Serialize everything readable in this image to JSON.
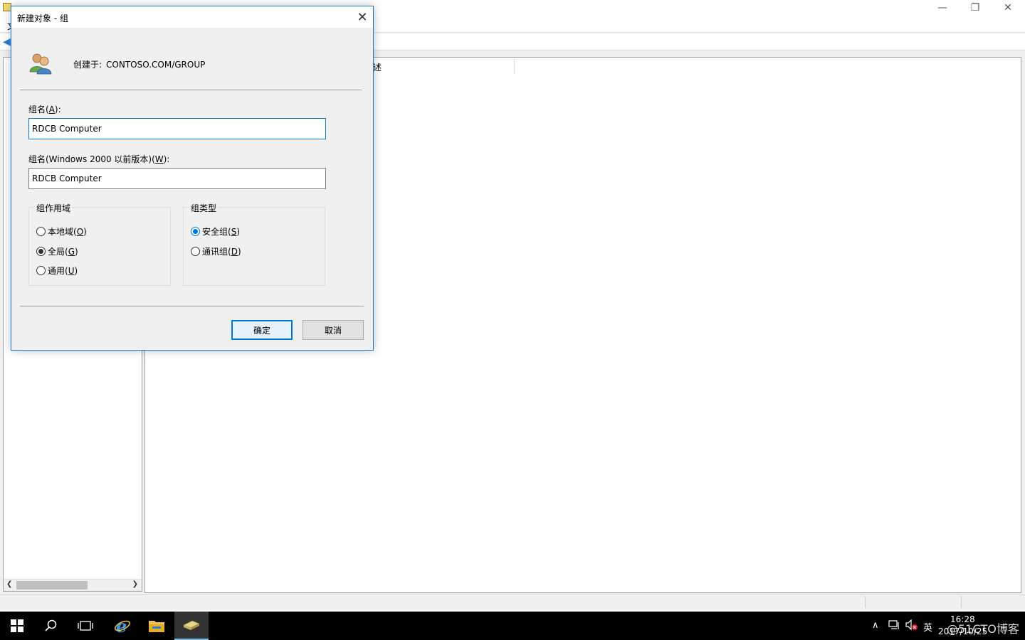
{
  "background_window": {
    "menu_first": "文",
    "column_desc": "述"
  },
  "dialog": {
    "title": "新建对象 - 组",
    "created_in_label": "创建于:",
    "created_in_path": "CONTOSO.COM/GROUP",
    "group_name": {
      "label_prefix": "组名(",
      "label_key": "A",
      "label_suffix": "):",
      "value": "RDCB Computer"
    },
    "group_name_pre2000": {
      "label_prefix": "组名(Windows 2000 以前版本)(",
      "label_key": "W",
      "label_suffix": "):",
      "value": "RDCB Computer"
    },
    "scope": {
      "legend": "组作用域",
      "options": [
        {
          "text": "本地域(",
          "key": "O",
          "end": ")",
          "checked": false
        },
        {
          "text": "全局(",
          "key": "G",
          "end": ")",
          "checked": true
        },
        {
          "text": "通用(",
          "key": "U",
          "end": ")",
          "checked": false
        }
      ]
    },
    "type": {
      "legend": "组类型",
      "options": [
        {
          "text": "安全组(",
          "key": "S",
          "end": ")",
          "checked": true
        },
        {
          "text": "通讯组(",
          "key": "D",
          "end": ")",
          "checked": false
        }
      ]
    },
    "ok_label": "确定",
    "cancel_label": "取消"
  },
  "taskbar": {
    "ime": "英",
    "time": "16:28",
    "date": "2017/10/25",
    "watermark": "@51CTO博客"
  },
  "colors": {
    "accent": "#0078d7",
    "dialog_border": "#1979ca",
    "taskbar": "#000000"
  }
}
